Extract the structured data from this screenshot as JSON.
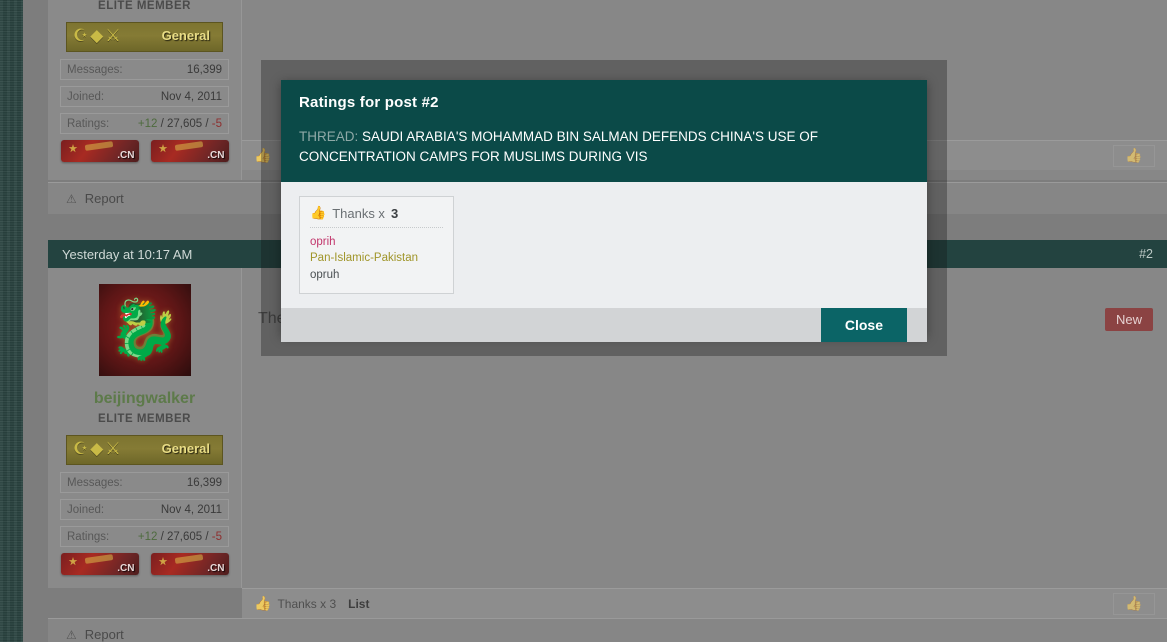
{
  "url_line": "https://www.newsweek.com/saudi-arab...nds-china-concentration-camps-muslims-1340592",
  "colors": {
    "modal_header_bg": "#0b4a48",
    "close_button_bg": "#0b6466",
    "post_header_bg": "#234340",
    "new_badge_bg": "#8b4343",
    "page_bg": "#7d7d7d",
    "rating_user_pink": "#c2356b",
    "rating_user_olive": "#a09529",
    "rating_user_gray": "#4a4f52",
    "rating_positive": "#4e6b3e",
    "rating_negative": "#8e2f2f",
    "username_color": "#5d7a4a"
  },
  "modal": {
    "title": "Ratings for post #2",
    "thread_label": "THREAD:",
    "thread_title": "SAUDI ARABIA'S MOHAMMAD BIN SALMAN DEFENDS CHINA'S USE OF CONCENTRATION CAMPS FOR MUSLIMS DURING VIS",
    "rating": {
      "icon": "thumbs-up-icon",
      "label": "Thanks x",
      "count": "3",
      "users": [
        {
          "name": "oprih",
          "style": "pink"
        },
        {
          "name": "Pan-Islamic-Pakistan",
          "style": "olive"
        },
        {
          "name": "opruh",
          "style": "gray"
        }
      ]
    },
    "close_label": "Close"
  },
  "post1": {
    "member_title": "ELITE MEMBER",
    "rank_badge": {
      "glyphs": "☪◆⚔",
      "name": "General"
    },
    "stats": [
      {
        "key": "Messages:",
        "value": "16,399"
      },
      {
        "key": "Joined:",
        "value": "Nov 4, 2011"
      }
    ],
    "ratings_row": {
      "key": "Ratings:",
      "positive": "+12",
      "sep1": " / ",
      "neutral": "27,605",
      "sep2": " / ",
      "negative": "-5"
    },
    "flags": [
      {
        "label": ".CN"
      },
      {
        "label": ".CN"
      }
    ],
    "report_label": "Report",
    "report_icon": "warning-triangle-icon",
    "thanks_icon": "thumbs-up-icon",
    "like_button_icon": "thumbs-up-icon"
  },
  "post2": {
    "timestamp": "Yesterday at 10:17 AM",
    "post_number": "#2",
    "avatar_icon": "dragon-avatar",
    "username": "beijingwalker",
    "member_title": "ELITE MEMBER",
    "rank_badge": {
      "glyphs": "☪◆⚔",
      "name": "General"
    },
    "stats": [
      {
        "key": "Messages:",
        "value": "16,399"
      },
      {
        "key": "Joined:",
        "value": "Nov 4, 2011"
      }
    ],
    "ratings_row": {
      "key": "Ratings:",
      "positive": "+12",
      "sep1": " / ",
      "neutral": "27,605",
      "sep2": " / ",
      "negative": "-5"
    },
    "flags": [
      {
        "label": ".CN"
      },
      {
        "label": ".CN"
      }
    ],
    "new_badge": "New",
    "post_text": "The",
    "footer": {
      "thanks_icon": "thumbs-up-icon",
      "thanks_text": "Thanks x 3",
      "list_label": "List",
      "like_button_icon": "thumbs-up-icon"
    },
    "report_label": "Report",
    "report_icon": "warning-triangle-icon"
  }
}
